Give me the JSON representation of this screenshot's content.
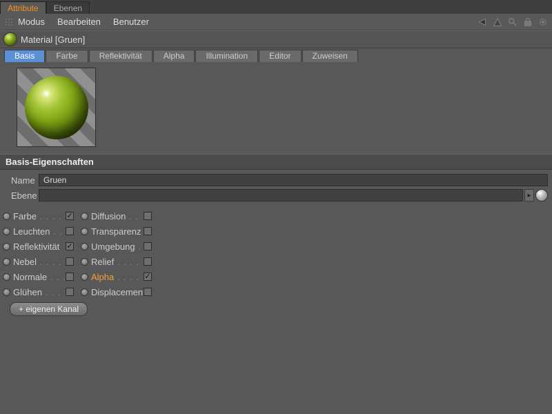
{
  "topTabs": {
    "attribute": "Attribute",
    "ebenen": "Ebenen"
  },
  "menu": {
    "modus": "Modus",
    "bearbeiten": "Bearbeiten",
    "benutzer": "Benutzer"
  },
  "object": {
    "type": "Material",
    "name": "Gruen",
    "title": "Material [Gruen]"
  },
  "subTabs": {
    "basis": "Basis",
    "farbe": "Farbe",
    "reflekt": "Reflektivität",
    "alpha": "Alpha",
    "illum": "Illumination",
    "editor": "Editor",
    "zuweisen": "Zuweisen"
  },
  "section": {
    "basisEigenschaften": "Basis-Eigenschaften"
  },
  "fields": {
    "nameLabel": "Name",
    "nameValue": "Gruen",
    "ebeneLabel": "Ebene",
    "ebeneValue": ""
  },
  "channels": {
    "col1": [
      {
        "label": "Farbe",
        "checked": true,
        "hl": false
      },
      {
        "label": "Leuchten",
        "checked": false,
        "hl": false
      },
      {
        "label": "Reflektivität",
        "checked": true,
        "hl": false
      },
      {
        "label": "Nebel",
        "checked": false,
        "hl": false
      },
      {
        "label": "Normale",
        "checked": false,
        "hl": false
      },
      {
        "label": "Glühen",
        "checked": false,
        "hl": false
      }
    ],
    "col2": [
      {
        "label": "Diffusion",
        "checked": false,
        "hl": false
      },
      {
        "label": "Transparenz",
        "checked": false,
        "hl": false
      },
      {
        "label": "Umgebung",
        "checked": false,
        "hl": false
      },
      {
        "label": "Relief",
        "checked": false,
        "hl": false
      },
      {
        "label": "Alpha",
        "checked": true,
        "hl": true
      },
      {
        "label": "Displacement",
        "checked": false,
        "hl": false
      }
    ]
  },
  "buttons": {
    "addChannel": "+ eigenen Kanal"
  },
  "colors": {
    "accent": "#f7931e",
    "activeTab": "#5b8fd6",
    "materialGreen": "#8bb019"
  }
}
